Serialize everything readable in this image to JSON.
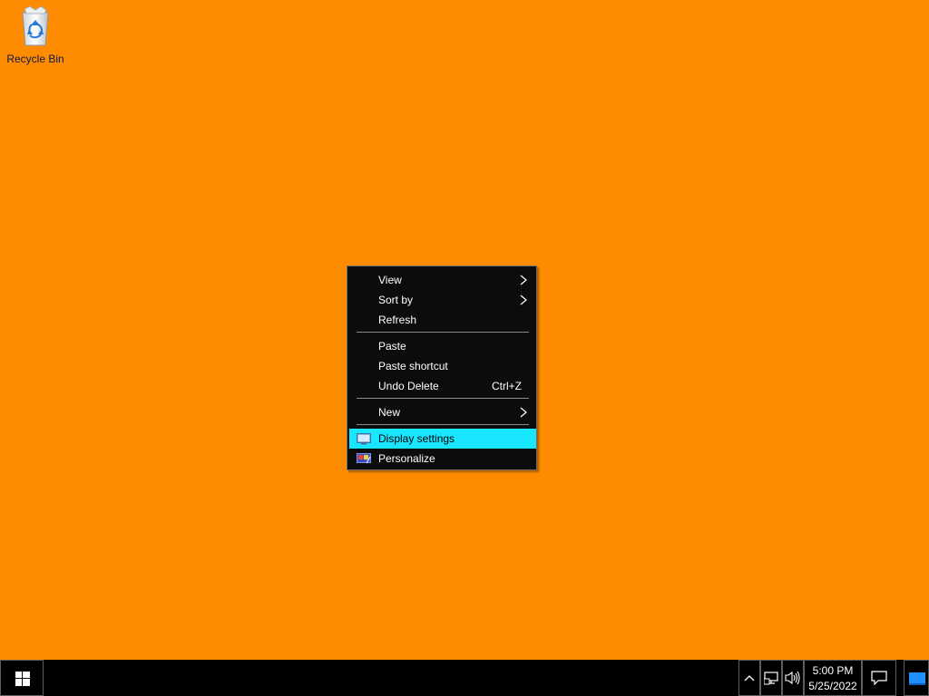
{
  "desktop": {
    "background_color": "#ff8c00",
    "icons": [
      {
        "label": "Recycle Bin",
        "icon": "recycle-bin-icon"
      }
    ]
  },
  "context_menu": {
    "items": [
      {
        "label": "View",
        "submenu": true
      },
      {
        "label": "Sort by",
        "submenu": true
      },
      {
        "label": "Refresh"
      },
      {
        "label": "Paste"
      },
      {
        "label": "Paste shortcut"
      },
      {
        "label": "Undo Delete",
        "shortcut": "Ctrl+Z"
      },
      {
        "label": "New",
        "submenu": true
      },
      {
        "label": "Display settings",
        "icon": "display-settings-icon",
        "highlighted": true
      },
      {
        "label": "Personalize",
        "icon": "personalize-icon"
      }
    ],
    "highlight_color": "#19e6ff"
  },
  "taskbar": {
    "start_icon": "windows-logo-icon",
    "tray": {
      "show_hidden_icon": "chevron-up-icon",
      "network_icon": "network-icon",
      "volume_icon": "volume-icon",
      "time": "5:00 PM",
      "date": "5/25/2022",
      "notification_icon": "action-center-icon",
      "show_desktop_icon": "show-desktop-icon"
    }
  }
}
